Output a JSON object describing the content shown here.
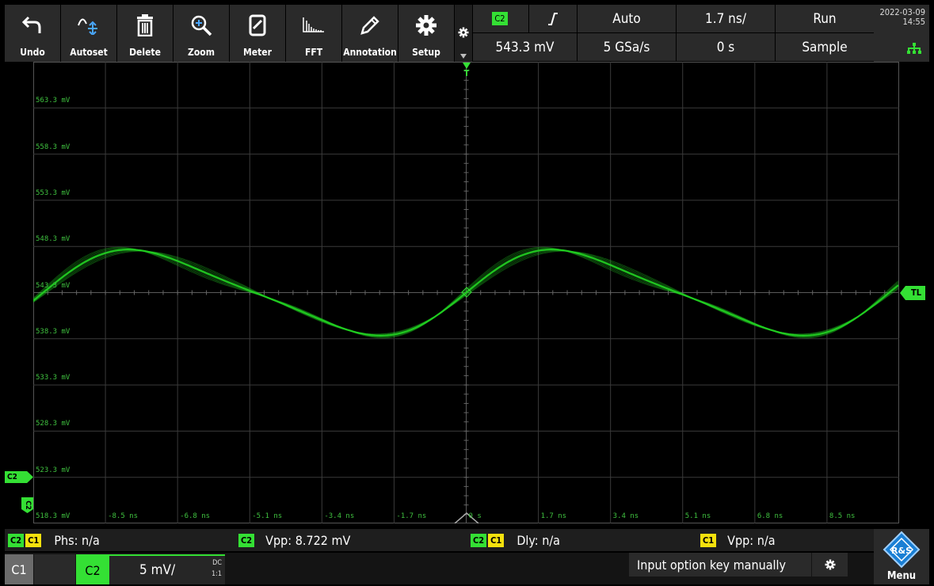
{
  "toolbar": {
    "buttons": [
      {
        "label": "Undo",
        "icon": "undo-icon"
      },
      {
        "label": "Autoset",
        "icon": "autoset-icon"
      },
      {
        "label": "Delete",
        "icon": "trash-icon"
      },
      {
        "label": "Zoom",
        "icon": "zoom-icon"
      },
      {
        "label": "Meter",
        "icon": "meter-icon"
      },
      {
        "label": "FFT",
        "icon": "fft-icon"
      },
      {
        "label": "Annotation",
        "icon": "pencil-icon"
      },
      {
        "label": "Setup",
        "icon": "gear-icon"
      }
    ]
  },
  "trigger": {
    "channel": "C2",
    "mode": "Auto",
    "level": "543.3 mV",
    "sample_rate": "5 GSa/s"
  },
  "timebase": {
    "scale": "1.7 ns/",
    "position": "0 s"
  },
  "acquisition": {
    "state": "Run",
    "mode": "Sample"
  },
  "datetime": {
    "date": "2022-03-09",
    "time": "14:55"
  },
  "screen": {
    "voltage_levels": [
      "563.3 mV",
      "558.3 mV",
      "553.3 mV",
      "548.3 mV",
      "543.3 mV",
      "538.3 mV",
      "533.3 mV",
      "528.3 mV",
      "523.3 mV",
      "518.3 mV"
    ],
    "time_ticks": [
      "-8.5 ns",
      "-6.8 ns",
      "-5.1 ns",
      "-3.4 ns",
      "-1.7 ns",
      "0 s",
      "1.7 ns",
      "3.4 ns",
      "5.1 ns",
      "6.8 ns",
      "8.5 ns"
    ],
    "trigger_level_tag": "TL",
    "trigger_marker": "T",
    "channel_marker": "C2",
    "channel_ground": "C2"
  },
  "measurements": [
    {
      "tags": [
        "C2",
        "C1"
      ],
      "label": "Phs:",
      "value": "n/a"
    },
    {
      "tags": [
        "C2"
      ],
      "label": "Vpp:",
      "value": "8.722 mV"
    },
    {
      "tags": [
        "C2",
        "C1"
      ],
      "label": "Dly:",
      "value": "n/a"
    },
    {
      "tags": [
        "C1"
      ],
      "label": "Vpp:",
      "value": "n/a"
    }
  ],
  "channels": {
    "c1_label": "C1",
    "c2_label": "C2",
    "c2_scale": "5 mV/",
    "c2_coupling": "DC",
    "c2_probe": "1:1"
  },
  "status": {
    "message": "Input option key manually"
  },
  "menu": {
    "label": "Menu",
    "logo_text": "R&S"
  },
  "colors": {
    "trace": "#22d022",
    "channel2": "#34e034",
    "channel1": "#f4e10d",
    "grid": "#3a3a3a"
  }
}
